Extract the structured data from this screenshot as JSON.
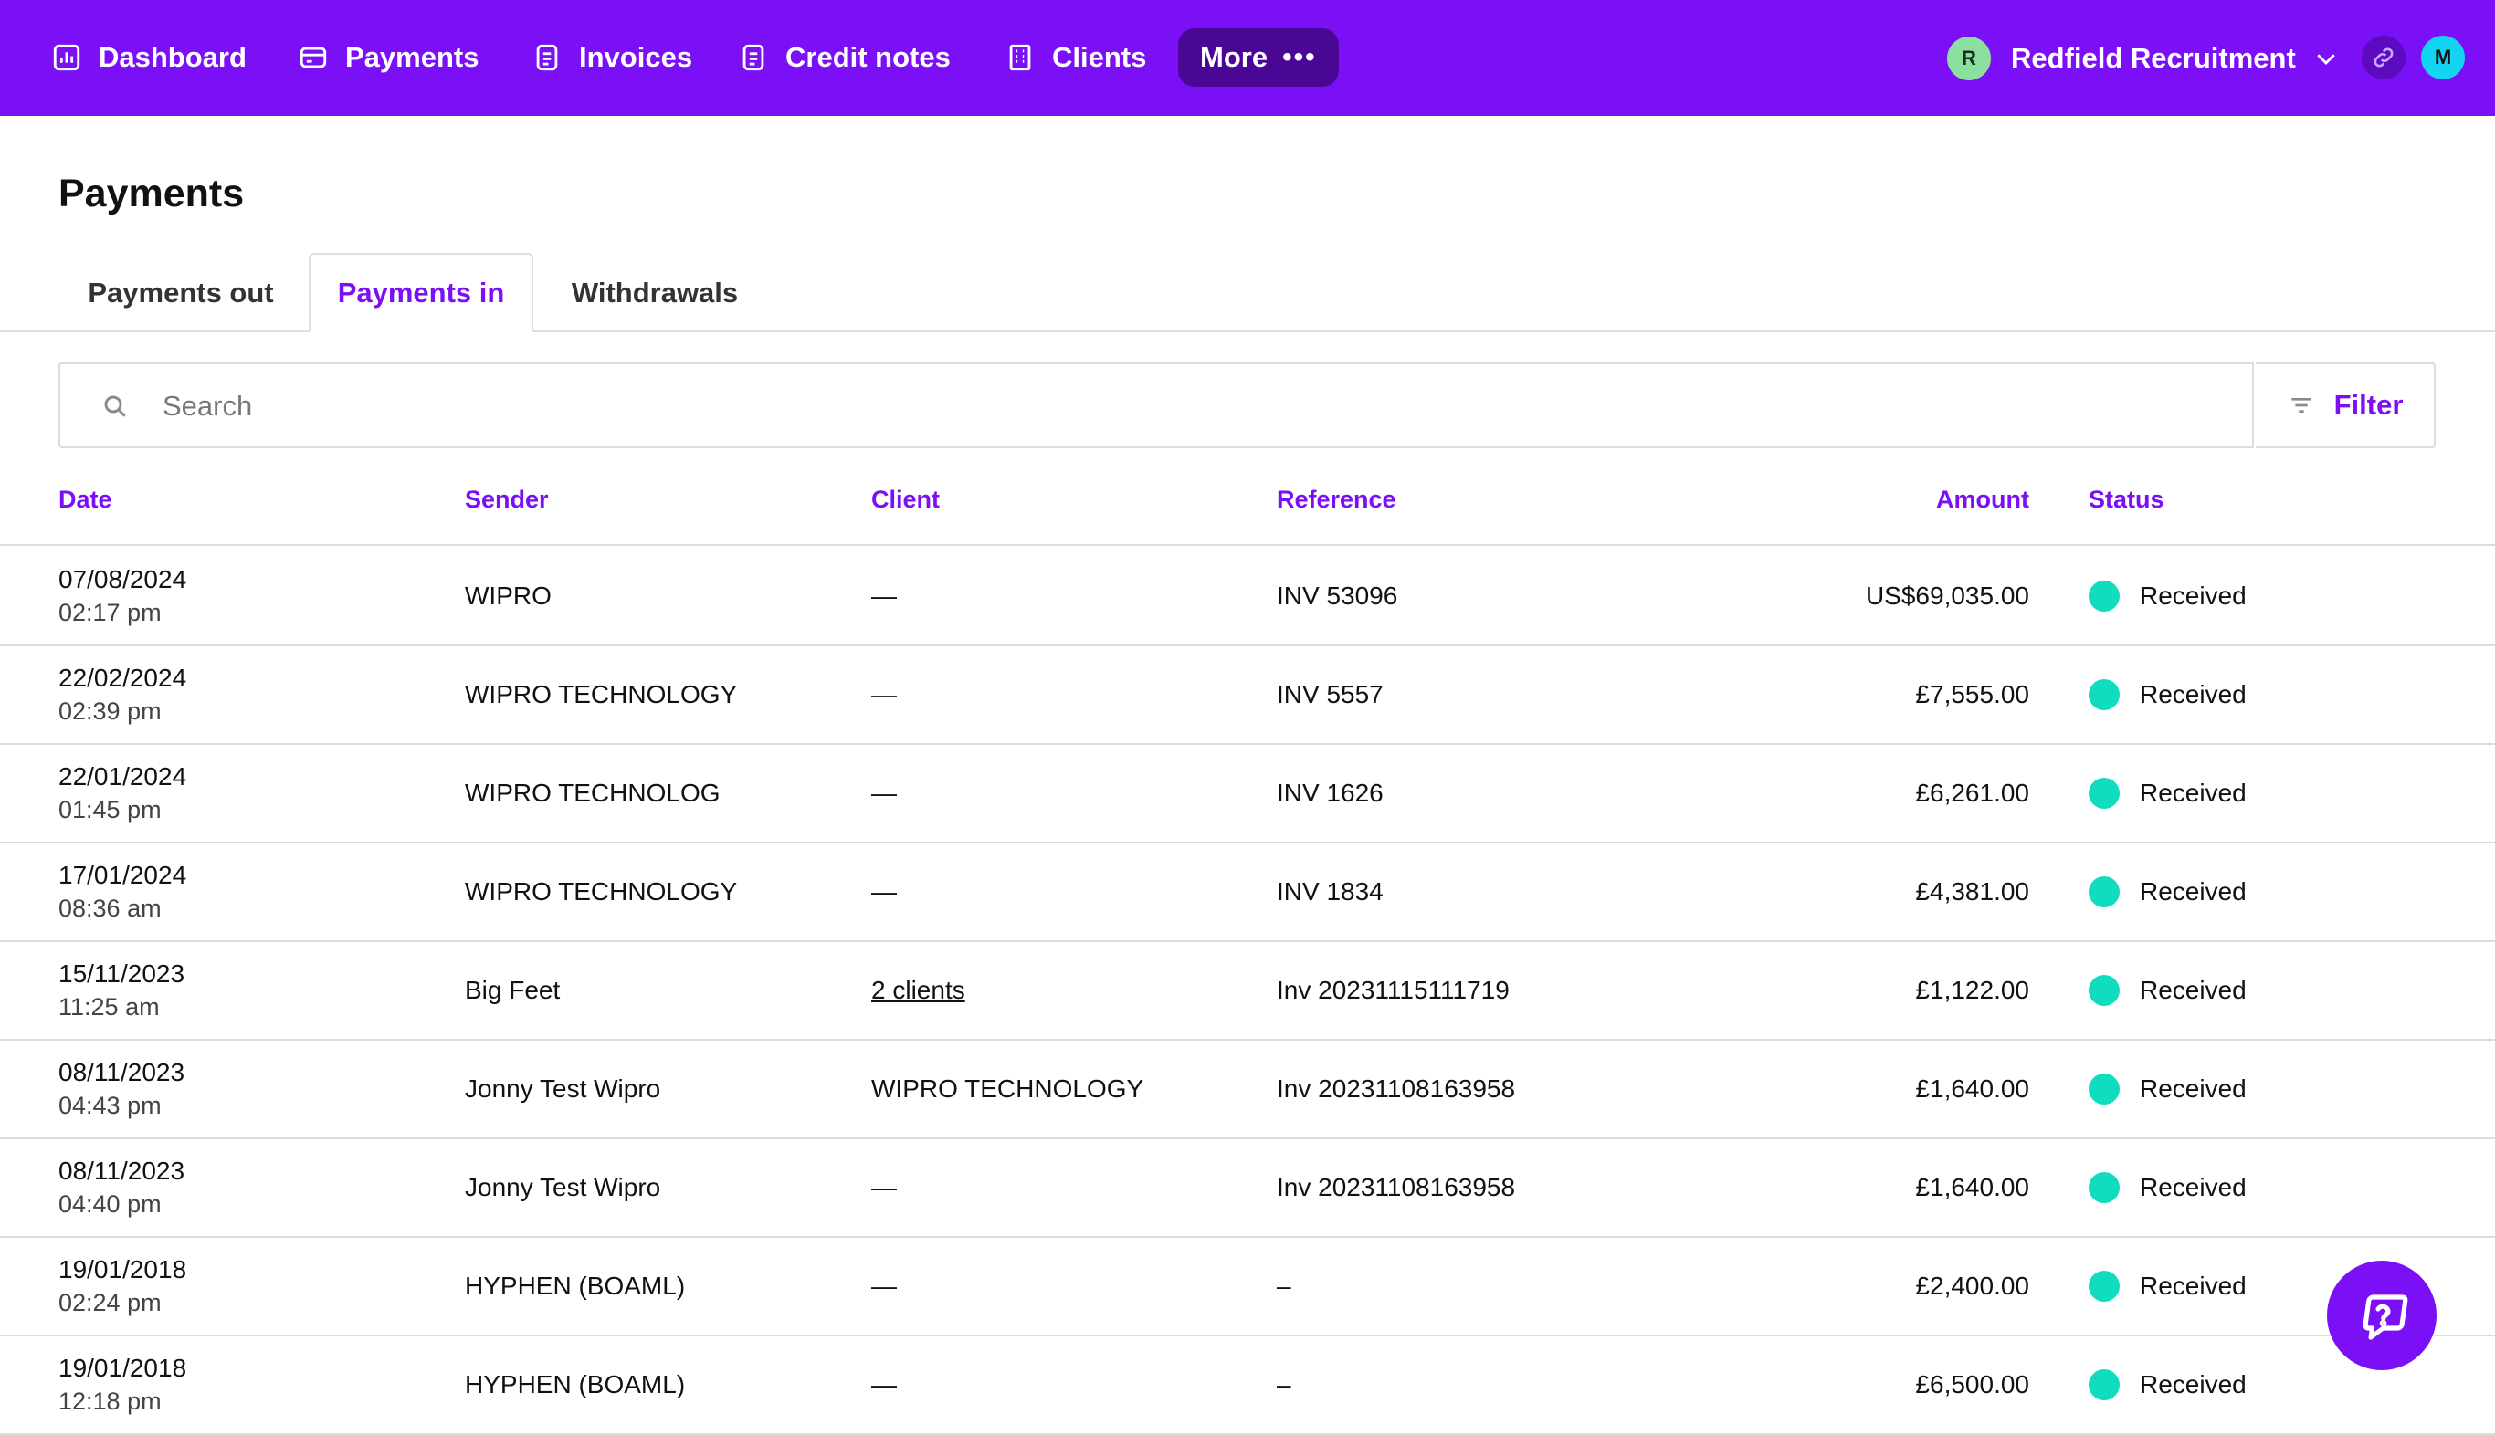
{
  "nav": {
    "items": [
      {
        "label": "Dashboard",
        "icon": "dashboard-icon"
      },
      {
        "label": "Payments",
        "icon": "card-icon"
      },
      {
        "label": "Invoices",
        "icon": "document-icon"
      },
      {
        "label": "Credit notes",
        "icon": "document-icon"
      },
      {
        "label": "Clients",
        "icon": "building-icon"
      }
    ],
    "more_label": "More",
    "org_initial": "R",
    "org_name": "Redfield Recruitment",
    "user_initial": "M"
  },
  "page": {
    "title": "Payments",
    "tabs": [
      {
        "label": "Payments out",
        "active": false
      },
      {
        "label": "Payments in",
        "active": true
      },
      {
        "label": "Withdrawals",
        "active": false
      }
    ]
  },
  "search": {
    "placeholder": "Search",
    "value": ""
  },
  "filter": {
    "label": "Filter"
  },
  "table": {
    "columns": [
      "Date",
      "Sender",
      "Client",
      "Reference",
      "Amount",
      "Status"
    ],
    "rows": [
      {
        "date": "07/08/2024",
        "time": "02:17 pm",
        "sender": "WIPRO",
        "client": "—",
        "reference": "INV 53096",
        "amount": "US$69,035.00",
        "status": "Received"
      },
      {
        "date": "22/02/2024",
        "time": "02:39 pm",
        "sender": "WIPRO TECHNOLOGY",
        "client": "—",
        "reference": "INV 5557",
        "amount": "£7,555.00",
        "status": "Received"
      },
      {
        "date": "22/01/2024",
        "time": "01:45 pm",
        "sender": "WIPRO TECHNOLOG",
        "client": "—",
        "reference": "INV 1626",
        "amount": "£6,261.00",
        "status": "Received"
      },
      {
        "date": "17/01/2024",
        "time": "08:36 am",
        "sender": "WIPRO TECHNOLOGY",
        "client": "—",
        "reference": "INV 1834",
        "amount": "£4,381.00",
        "status": "Received"
      },
      {
        "date": "15/11/2023",
        "time": "11:25 am",
        "sender": "Big Feet",
        "client": "2 clients",
        "reference": "Inv 20231115111719",
        "amount": "£1,122.00",
        "status": "Received"
      },
      {
        "date": "08/11/2023",
        "time": "04:43 pm",
        "sender": "Jonny Test Wipro",
        "client": "WIPRO TECHNOLOGY",
        "reference": "Inv 20231108163958",
        "amount": "£1,640.00",
        "status": "Received"
      },
      {
        "date": "08/11/2023",
        "time": "04:40 pm",
        "sender": "Jonny Test Wipro",
        "client": "—",
        "reference": "Inv 20231108163958",
        "amount": "£1,640.00",
        "status": "Received"
      },
      {
        "date": "19/01/2018",
        "time": "02:24 pm",
        "sender": "HYPHEN (BOAML)",
        "client": "—",
        "reference": "–",
        "amount": "£2,400.00",
        "status": "Received"
      },
      {
        "date": "19/01/2018",
        "time": "12:18 pm",
        "sender": "HYPHEN (BOAML)",
        "client": "—",
        "reference": "–",
        "amount": "£6,500.00",
        "status": "Received"
      }
    ]
  },
  "colors": {
    "brand": "#7b0ff5",
    "status_received": "#11dcbf"
  }
}
